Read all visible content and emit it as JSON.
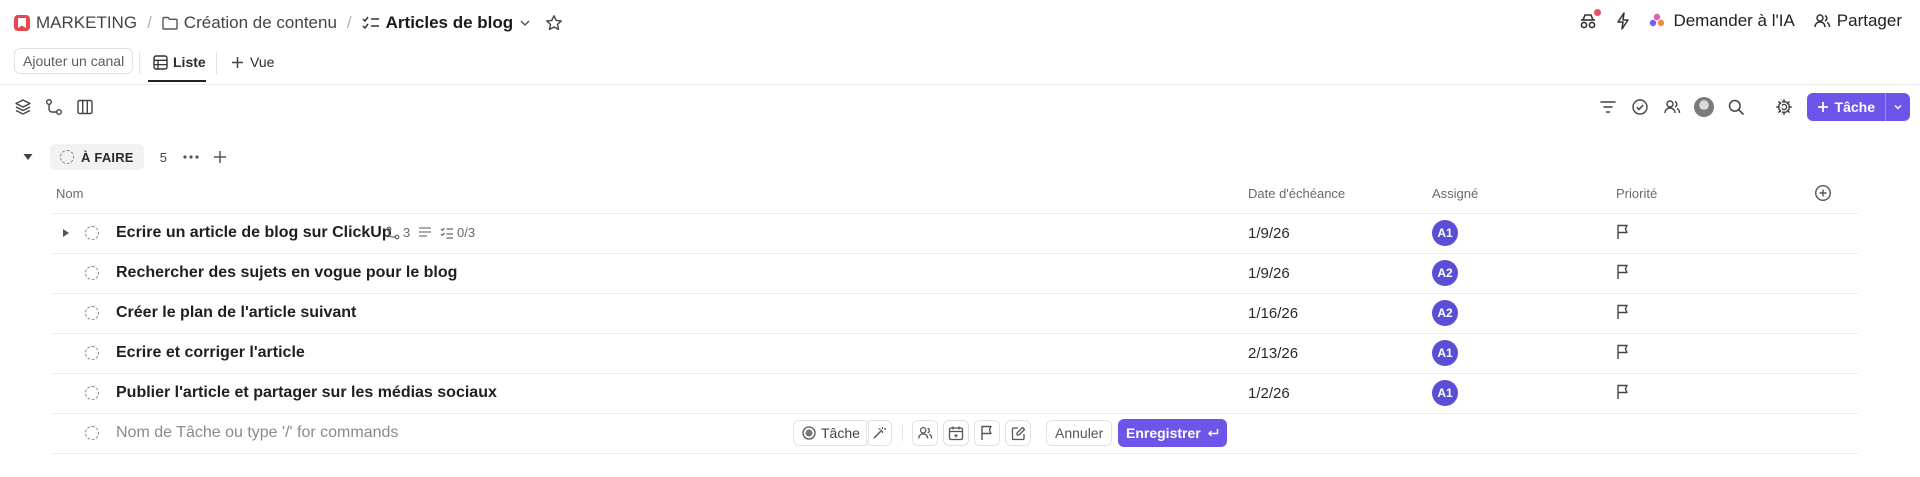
{
  "breadcrumb": {
    "workspace": "MARKETING",
    "folder": "Création de contenu",
    "list": "Articles de blog"
  },
  "header_actions": {
    "ask_ai": "Demander à l'IA",
    "share": "Partager"
  },
  "tabs": {
    "add_channel": "Ajouter un canal",
    "list_view": "Liste",
    "add_view": "Vue"
  },
  "toolbar": {
    "new_task": "Tâche"
  },
  "group": {
    "status": "À FAIRE",
    "count": "5"
  },
  "columns": {
    "name": "Nom",
    "due": "Date d'échéance",
    "assignee": "Assigné",
    "priority": "Priorité"
  },
  "tasks": [
    {
      "name": "Ecrire un article de blog sur ClickUp",
      "due": "1/9/26",
      "assignee": "A1",
      "subtasks": "3",
      "checklist": "0/3"
    },
    {
      "name": "Rechercher des sujets en vogue pour le blog",
      "due": "1/9/26",
      "assignee": "A2"
    },
    {
      "name": "Créer le plan de l'article suivant",
      "due": "1/16/26",
      "assignee": "A2"
    },
    {
      "name": "Ecrire et corriger l'article",
      "due": "2/13/26",
      "assignee": "A1"
    },
    {
      "name": "Publier l'article et partager sur les médias sociaux",
      "due": "1/2/26",
      "assignee": "A1"
    }
  ],
  "new_task": {
    "placeholder": "Nom de Tâche ou type '/' for commands",
    "type_label": "Tâche",
    "cancel": "Annuler",
    "save": "Enregistrer"
  },
  "colors": {
    "accent": "#6c55e8",
    "avatar": "#5a4fd6",
    "workspace_badge": "#e5484d"
  }
}
